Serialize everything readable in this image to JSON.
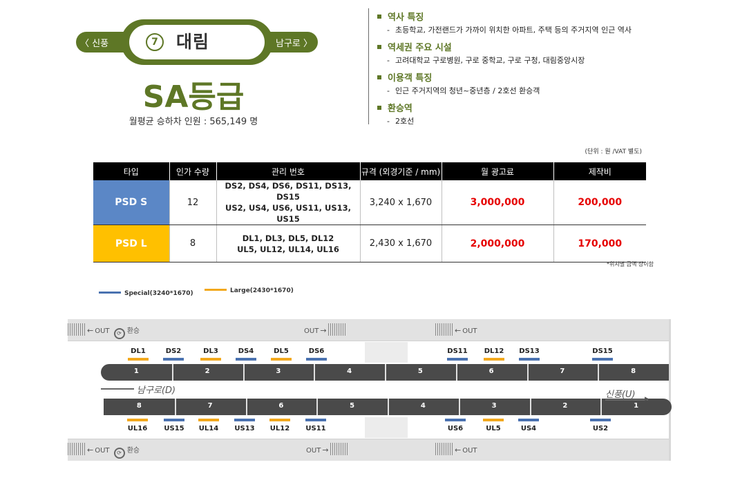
{
  "station": {
    "prev": "〈 신풍",
    "next": "남구로 〉",
    "number": "7",
    "name": "대림",
    "grade": "SA등급",
    "avg_passengers": "월평균 승하차 인원 : 565,149 명"
  },
  "features": [
    {
      "title": "역사 특징",
      "desc": "초등학교, 가전랜드가 가까이 위치한 아파트, 주택 등의 주거지역 인근 역사"
    },
    {
      "title": "역세권 주요 시설",
      "desc": "고려대학교 구로병원, 구로 중학교, 구로 구청, 대림중앙시장"
    },
    {
      "title": "이용객 특징",
      "desc": "인근 주거지역의 청년~중년층 / 2호선 환승객"
    },
    {
      "title": "환승역",
      "desc": "2호선"
    }
  ],
  "table": {
    "unit_note": "(단위 : 원 /VAT 별도)",
    "headers": [
      "타입",
      "인가 수량",
      "관리 번호",
      "규격 (외경기준 / mm)",
      "월 광고료",
      "제작비"
    ],
    "rows": [
      {
        "type": "PSD S",
        "qty": "12",
        "ids1": "DS2, DS4, DS6, DS11, DS13, DS15",
        "ids2": "US2, US4, US6, US11, US13, US15",
        "size": "3,240 x 1,670",
        "monthly": "3,000,000",
        "production": "200,000",
        "color": "#5b87c6"
      },
      {
        "type": "PSD L",
        "qty": "8",
        "ids1": "DL1, DL3, DL5, DL12",
        "ids2": "UL5, UL12, UL14, UL16",
        "size": "2,430 x 1,670",
        "monthly": "2,000,000",
        "production": "170,000",
        "color": "#ffc000"
      }
    ],
    "foot_note": "*위치별 금액 상이함"
  },
  "legend": {
    "special": "Special(3240*1670)",
    "large": "Large(2430*1670)",
    "special_color": "#4a72b0",
    "large_color": "#f2a81d"
  },
  "platform": {
    "exit_label": "OUT",
    "transfer_label": "환승",
    "top_train_cars": [
      "1",
      "2",
      "3",
      "4",
      "5",
      "6",
      "7",
      "8"
    ],
    "bottom_train_cars": [
      "8",
      "7",
      "6",
      "5",
      "4",
      "3",
      "2",
      "1"
    ],
    "direction_down": "남구로(D)",
    "direction_up": "신풍(U)",
    "top_ads": [
      "DL1",
      "DS2",
      "DL3",
      "DS4",
      "DL5",
      "DS6",
      "DS11",
      "DL12",
      "DS13",
      "DS15"
    ],
    "bottom_ads": [
      "UL16",
      "US15",
      "UL14",
      "US13",
      "UL12",
      "US11",
      "US6",
      "UL5",
      "US4",
      "US2"
    ]
  }
}
